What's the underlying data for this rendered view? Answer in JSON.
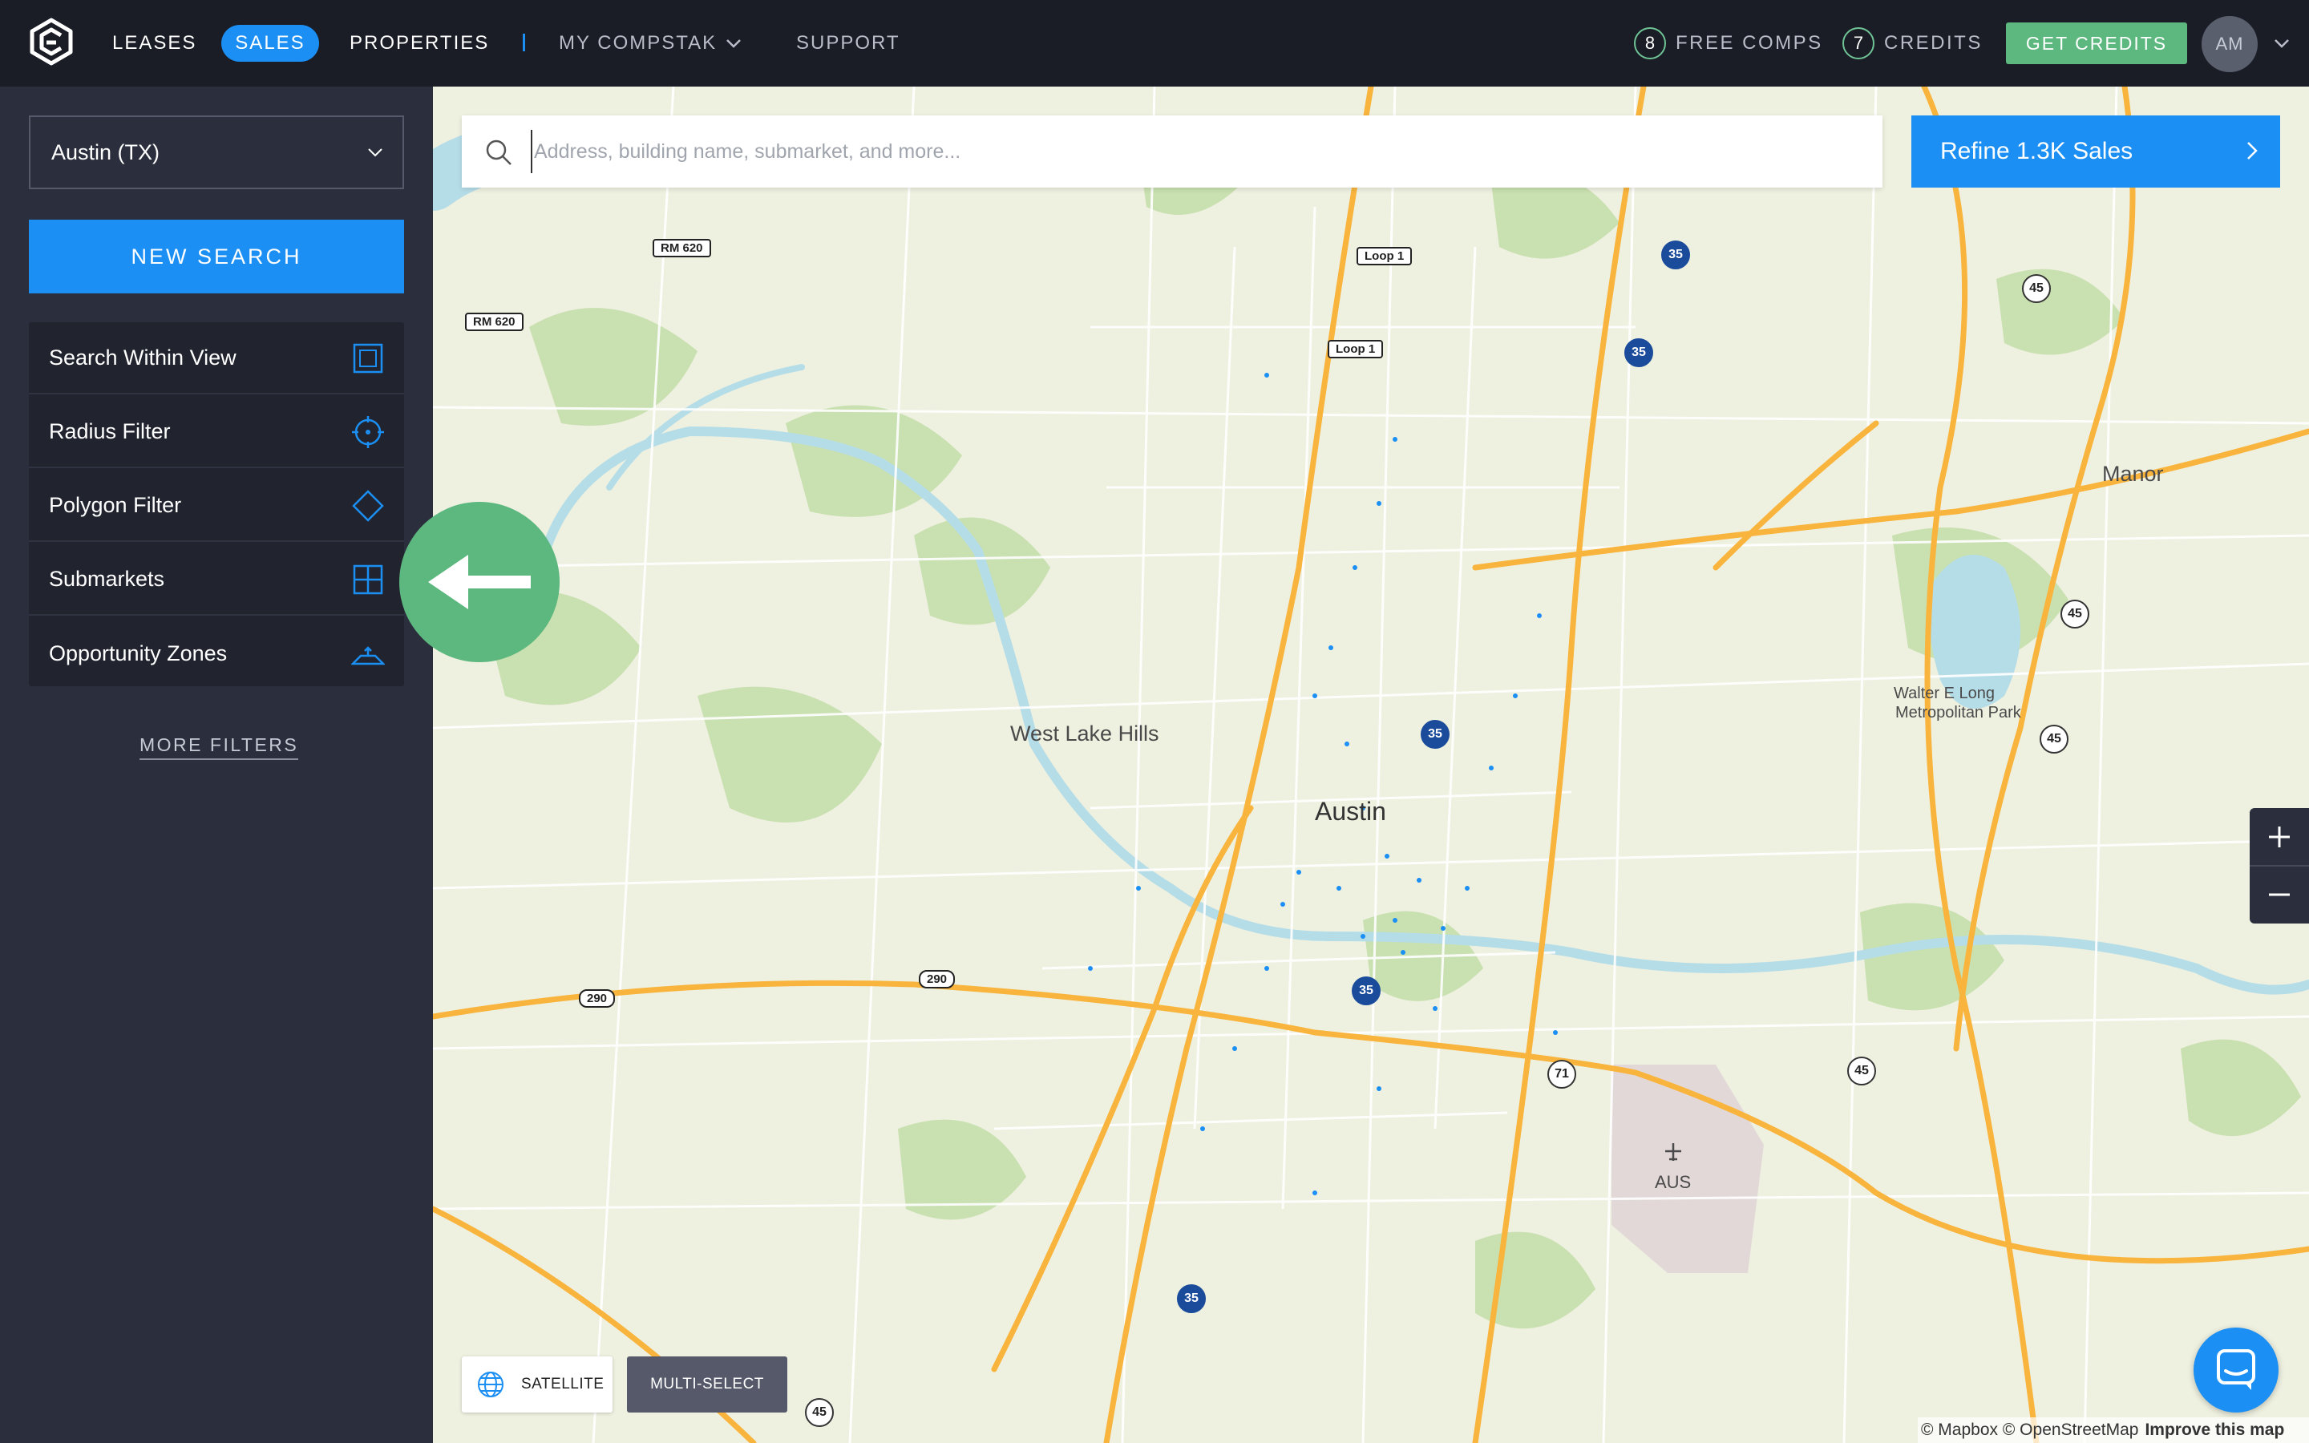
{
  "topbar": {
    "logo_icon": "compstak-logo-icon",
    "nav": {
      "leases": "LEASES",
      "sales": "SALES",
      "properties": "PROPERTIES",
      "my_compstak": "MY COMPSTAK",
      "support": "SUPPORT"
    },
    "free_comps_count": "8",
    "free_comps_label": "FREE COMPS",
    "credits_count": "7",
    "credits_label": "CREDITS",
    "get_credits": "GET CREDITS",
    "avatar_initials": "AM"
  },
  "sidebar": {
    "market": "Austin (TX)",
    "new_search": "NEW SEARCH",
    "filters": [
      {
        "label": "Search Within View",
        "icon": "search-within-view-icon"
      },
      {
        "label": "Radius Filter",
        "icon": "radius-target-icon"
      },
      {
        "label": "Polygon Filter",
        "icon": "polygon-icon"
      },
      {
        "label": "Submarkets",
        "icon": "grid-icon"
      },
      {
        "label": "Opportunity Zones",
        "icon": "opportunity-zone-icon"
      }
    ],
    "more_filters": "MORE FILTERS"
  },
  "search": {
    "placeholder": "Address, building name, submarket, and more...",
    "value": ""
  },
  "refine_button": "Refine 1.3K Sales",
  "map": {
    "places": {
      "austin": "Austin",
      "west_lake_hills": "West Lake Hills",
      "manor": "Manor",
      "walter_e_long_1": "Walter E Long",
      "walter_e_long_2": "Metropolitan Park",
      "aus": "AUS"
    },
    "shields": {
      "rm620_a": "RM 620",
      "rm620_b": "RM 620",
      "loop1_a": "Loop 1",
      "loop1_b": "Loop 1",
      "us290_a": "290",
      "us290_b": "290",
      "i35_a": "35",
      "i35_b": "35",
      "i35_c": "35",
      "i35_d": "35",
      "i35_e": "35",
      "sh45_a": "45",
      "sh45_b": "45",
      "sh45_c": "45",
      "sh45_d": "45",
      "sh45_e": "45",
      "sh71": "71"
    },
    "controls": {
      "zoom_in": "+",
      "zoom_out": "−",
      "satellite": "SATELLITE",
      "multi_select": "MULTI-SELECT"
    },
    "attribution": {
      "mapbox": "© Mapbox",
      "osm": "© OpenStreetMap",
      "improve": "Improve this map"
    }
  },
  "colors": {
    "topbar_bg": "#1a1d26",
    "sidebar_bg": "#2b2f3d",
    "accent_blue": "#1b8ff3",
    "accent_green": "#5db87f",
    "map_land": "#eef0e0",
    "map_park": "#c9e0b0",
    "map_water": "#b5dde8",
    "map_highway": "#f8b43c"
  }
}
